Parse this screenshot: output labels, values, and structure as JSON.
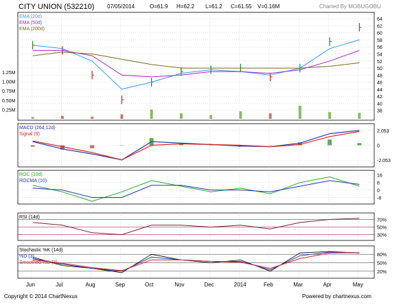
{
  "header": {
    "title": "CITY UNION (532210)",
    "date": "07/05/2014",
    "open": "O=61.9",
    "high": "H=62.2",
    "low": "L=61.2",
    "close": "C=61.55",
    "volume": "V=0.16M",
    "credit": "Charted By MOBUGOBU"
  },
  "footer": {
    "copyright": "Copyright © 2014 ChartNexus",
    "powered": "Powered by chartnexus.com"
  },
  "colors": {
    "ema20": "#3399ff",
    "ema50": "#aa22cc",
    "ema200": "#7a6a1a",
    "up": "#1a8a1a",
    "down": "#cc2222",
    "grid": "#b8b8b8",
    "volume_up": "#88bb66",
    "volume_down": "#cc7766"
  },
  "chart_data": {
    "type": "line",
    "x": [
      "Jun",
      "Jul",
      "Aug",
      "Sep",
      "Oct",
      "Nov",
      "Dec",
      "2014",
      "Feb",
      "Mar",
      "Apr",
      "May"
    ],
    "panels": {
      "price": {
        "series": [
          {
            "name": "EMA (20d)",
            "values": [
              56.5,
              55.5,
              52.0,
              44.0,
              46.0,
              48.5,
              49.5,
              49.0,
              48.0,
              50.0,
              55.5,
              58.0
            ]
          },
          {
            "name": "EMA (50d)",
            "values": [
              55.0,
              55.0,
              53.5,
              48.0,
              47.5,
              48.0,
              49.0,
              49.0,
              48.5,
              49.5,
              52.0,
              55.0
            ]
          },
          {
            "name": "EMA (200d)",
            "values": [
              53.5,
              54.5,
              54.0,
              52.5,
              51.0,
              50.0,
              50.0,
              50.0,
              50.0,
              50.0,
              50.5,
              51.5
            ]
          }
        ],
        "close": [
          56.5,
          55.0,
          48.0,
          41.0,
          46.0,
          49.0,
          49.5,
          50.0,
          47.5,
          50.0,
          57.5,
          61.55
        ],
        "yticks": [
          "64",
          "62",
          "60",
          "58",
          "56",
          "54",
          "52",
          "50",
          "48",
          "46",
          "44",
          "42",
          "40",
          "38"
        ],
        "ylim": [
          36,
          65
        ]
      },
      "volume": {
        "yticks": [
          "1.25M",
          "1.00M",
          "0.75M",
          "0.50M",
          "0.25M"
        ],
        "values": [
          0.05,
          0.08,
          0.06,
          0.12,
          0.25,
          0.15,
          0.1,
          0.2,
          0.15,
          0.35,
          0.18,
          0.16
        ]
      },
      "macd": {
        "series": [
          {
            "name": "MACD (26d,12d)",
            "values": [
              0.5,
              -0.5,
              -1.2,
              -2.0,
              0.5,
              0.3,
              0.1,
              -0.1,
              -0.2,
              0.3,
              1.6,
              2.05
            ]
          },
          {
            "name": "Signal (9)",
            "values": [
              0.6,
              -0.2,
              -1.0,
              -2.0,
              0.0,
              0.2,
              0.1,
              0.0,
              -0.2,
              0.1,
              1.2,
              1.9
            ]
          }
        ],
        "yticks": [
          "2.053",
          "0",
          "-2.053"
        ]
      },
      "roc": {
        "series": [
          {
            "name": "ROC (10d)",
            "values": [
              5,
              -2,
              -12,
              -2,
              10,
              4,
              -2,
              2,
              -4,
              8,
              14,
              4
            ]
          },
          {
            "name": "ROCMA (10)",
            "values": [
              2,
              0,
              -8,
              -8,
              5,
              5,
              0,
              0,
              -2,
              4,
              10,
              6
            ]
          }
        ],
        "yticks": [
          "16",
          "8",
          "0",
          "-8"
        ]
      },
      "rsi": {
        "series": [
          {
            "name": "RSI (14d)",
            "values": [
              62,
              55,
              35,
              30,
              55,
              55,
              50,
              55,
              45,
              62,
              70,
              73
            ]
          }
        ],
        "yticks": [
          "70%",
          "50%",
          "30%"
        ]
      },
      "stochastic": {
        "series": [
          {
            "name": "Stochastic %K (14d)",
            "values": [
              70,
              40,
              30,
              15,
              80,
              60,
              50,
              60,
              20,
              85,
              90,
              85
            ]
          },
          {
            "name": "%D (3)",
            "values": [
              65,
              45,
              30,
              20,
              70,
              60,
              55,
              55,
              25,
              75,
              88,
              85
            ]
          },
          {
            "name": "Smoothed %D (3)",
            "values": [
              60,
              48,
              33,
              22,
              60,
              60,
              55,
              52,
              30,
              65,
              85,
              86
            ]
          }
        ],
        "yticks": [
          "80%",
          "50%",
          "20%"
        ]
      }
    }
  }
}
